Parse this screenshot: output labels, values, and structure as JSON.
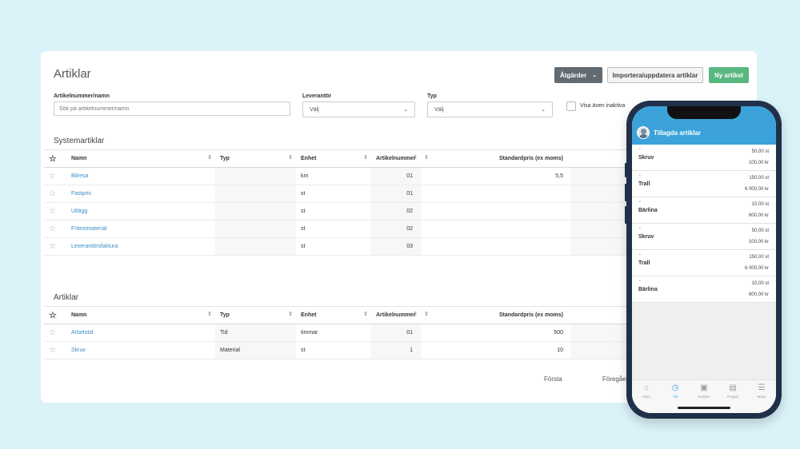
{
  "page": {
    "title": "Artiklar"
  },
  "toolbar": {
    "actions_label": "Åtgärder",
    "import_label": "Importera/uppdatera artiklar",
    "new_label": "Ny artikel"
  },
  "filters": {
    "article_label": "Artikelnummer/namn",
    "article_placeholder": "Sök på artikelnummer/namn",
    "supplier_label": "Leverantör",
    "supplier_value": "Välj",
    "type_label": "Typ",
    "type_value": "Välj",
    "inactive_label": "Visa även inaktiva"
  },
  "columns": {
    "name": "Namn",
    "type": "Typ",
    "unit": "Enhet",
    "number": "Artikelnummer",
    "price": "Standardpris (ex moms)"
  },
  "system_articles": {
    "title": "Systemartiklar",
    "rows": [
      {
        "name": "Bilresa",
        "type": "",
        "unit": "km",
        "number": "01",
        "price": "5,5"
      },
      {
        "name": "Fastpris",
        "type": "",
        "unit": "st",
        "number": "01",
        "price": ""
      },
      {
        "name": "Utlägg",
        "type": "",
        "unit": "st",
        "number": "02",
        "price": ""
      },
      {
        "name": "Fritextmaterial",
        "type": "",
        "unit": "st",
        "number": "02",
        "price": ""
      },
      {
        "name": "Leverantörsfaktura",
        "type": "",
        "unit": "st",
        "number": "03",
        "price": ""
      }
    ]
  },
  "articles": {
    "title": "Artiklar",
    "rows": [
      {
        "name": "Arbetstid",
        "type": "Tid",
        "unit": "timmar",
        "number": "01",
        "price": "500"
      },
      {
        "name": "Skruv",
        "type": "Material",
        "unit": "st",
        "number": "1",
        "price": "10"
      }
    ]
  },
  "pagination": {
    "first": "Första",
    "previous": "Föregåen"
  },
  "phone": {
    "header_title": "Tillagda artiklar",
    "items": [
      {
        "name": "Skruv",
        "qty": "50,00 st",
        "price": "100,00 kr"
      },
      {
        "name": "Trall",
        "qty": "150,00 st",
        "price": "6 000,00 kr"
      },
      {
        "name": "Bärlina",
        "qty": "10,00 st",
        "price": "600,00 kr"
      },
      {
        "name": "Skruv",
        "qty": "50,00 st",
        "price": "100,00 kr"
      },
      {
        "name": "Trall",
        "qty": "150,00 st",
        "price": "6 000,00 kr"
      },
      {
        "name": "Bärlina",
        "qty": "10,00 st",
        "price": "600,00 kr"
      }
    ],
    "tabs": [
      {
        "label": "Hem",
        "icon": "home-icon"
      },
      {
        "label": "Tid",
        "icon": "clock-icon"
      },
      {
        "label": "Kvitton",
        "icon": "receipt-icon"
      },
      {
        "label": "Projekt",
        "icon": "project-icon"
      },
      {
        "label": "Meny",
        "icon": "menu-icon"
      }
    ],
    "active_tab": "Tid"
  },
  "colors": {
    "accent": "#3ba3d9",
    "primary_button": "#58b77f",
    "dark_button": "#626a72",
    "link": "#3b8ec6",
    "background": "#d9f3f9"
  }
}
